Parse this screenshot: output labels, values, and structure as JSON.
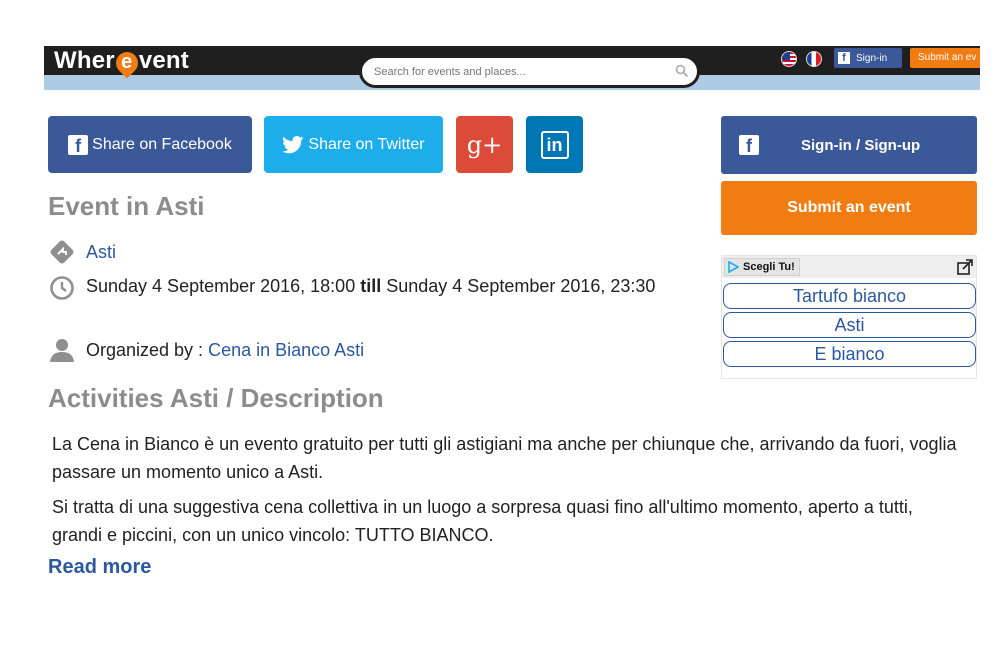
{
  "header": {
    "logo_left": "Wher",
    "logo_e": "e",
    "logo_right": "vent",
    "search_placeholder": "Search for events and places...",
    "signin_label": "Sign-in",
    "submit_label": "Submit an ev"
  },
  "share": {
    "facebook_label": "Share on Facebook",
    "twitter_label": "Share on Twitter",
    "googleplus_label": "g+",
    "linkedin_label": "in"
  },
  "event": {
    "heading": "Event in Asti",
    "location": "Asti",
    "date_start": "Sunday 4 September 2016, 18:00",
    "date_till": "till",
    "date_end": "Sunday 4 September 2016, 23:30",
    "organized_prefix": "Organized by :",
    "organizer": "Cena in Bianco Asti"
  },
  "description": {
    "heading": "Activities Asti / Description",
    "paragraph1": "La Cena in Bianco è un evento gratuito per tutti gli astigiani ma anche per chiunque che, arrivando da fuori, voglia passare un momento unico a Asti.",
    "paragraph2": "Si tratta di una suggestiva cena collettiva in un luogo a sorpresa quasi fino all'ultimo momento, aperto a tutti, grandi e piccini, con un unico vincolo: TUTTO BIANCO.",
    "read_more": "Read more"
  },
  "sidebar": {
    "signin_label": "Sign-in / Sign-up",
    "submit_label": "Submit an event",
    "ad": {
      "badge": "Scegli Tu!",
      "items": [
        "Tartufo bianco",
        "Asti",
        "E bianco"
      ]
    }
  },
  "colors": {
    "facebook": "#3b5998",
    "twitter": "#1dadeb",
    "googleplus": "#dc4a38",
    "linkedin": "#0077b5",
    "orange": "#f07c12",
    "link": "#2b58a0",
    "heading_gray": "#8c8c8c"
  }
}
